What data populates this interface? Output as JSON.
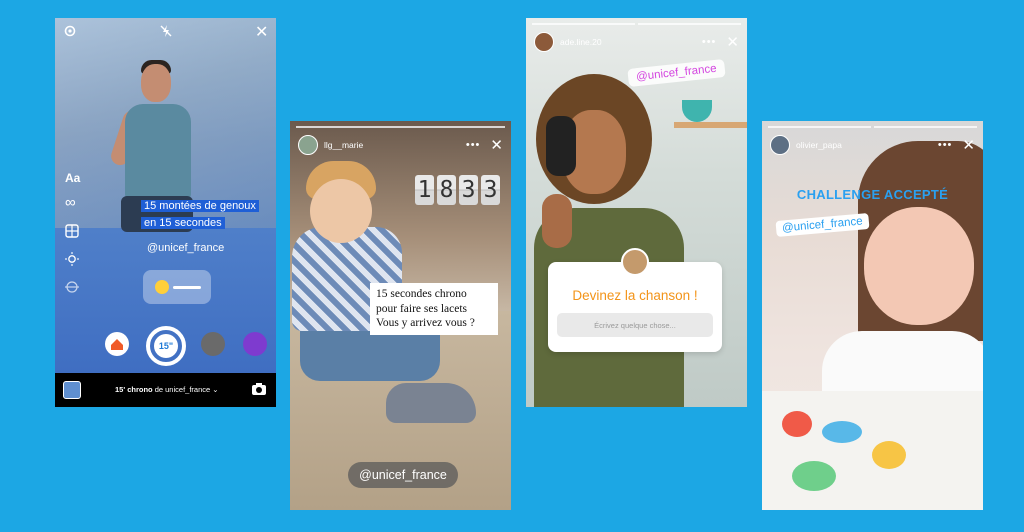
{
  "camera": {
    "text_line1": "15 montées de genoux",
    "text_line2": "en 15 secondes",
    "mention": "@unicef_france",
    "text_tool": "Aa",
    "timer": "15\"",
    "bottom_label": "15' chrono de unicef_france",
    "bottom_label_bold": "15' chrono",
    "bottom_label_rest": " de unicef_france"
  },
  "story_laces": {
    "username": "llg__marie",
    "clock": [
      "1",
      "8",
      "3",
      "3"
    ],
    "note_lines": [
      "15 secondes chrono",
      "pour faire ses lacets",
      "Vous y arrivez vous ?"
    ],
    "mention": "@unicef_france"
  },
  "story_song": {
    "username": "ade.line.20",
    "mention": "@unicef_france",
    "question": "Devinez la chanson !",
    "placeholder": "Écrivez quelque chose..."
  },
  "story_drawing": {
    "username": "olivier_papa",
    "challenge": "CHALLENGE ACCEPTÉ",
    "mention": "@unicef_france"
  },
  "colors": {
    "background": "#1ca7e4",
    "highlight": "#1f5fd6",
    "question_orange": "#f39419",
    "mention_pink": "#d446e0",
    "challenge_blue": "#2aa0f0"
  }
}
